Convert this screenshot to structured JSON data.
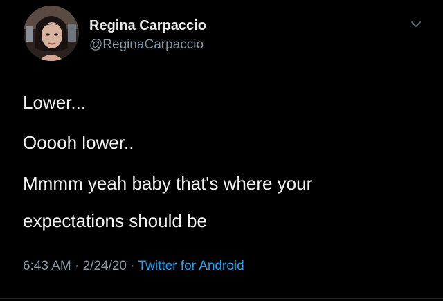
{
  "tweet": {
    "author": {
      "display_name": "Regina Carpaccio",
      "handle": "@ReginaCarpaccio"
    },
    "lines": [
      "Lower...",
      "Ooooh lower..",
      "Mmmm yeah baby that's where your",
      "expectations should be"
    ],
    "meta": {
      "time": "6:43 AM",
      "separator": " · ",
      "date": "2/24/20",
      "source": "Twitter for Android"
    }
  },
  "icons": {
    "menu_caret": "chevron-down-icon",
    "avatar": "profile-photo"
  },
  "colors": {
    "background": "#000000",
    "primary_text": "#f2f2f2",
    "secondary_text": "#8899a6",
    "link": "#1da1f2"
  }
}
